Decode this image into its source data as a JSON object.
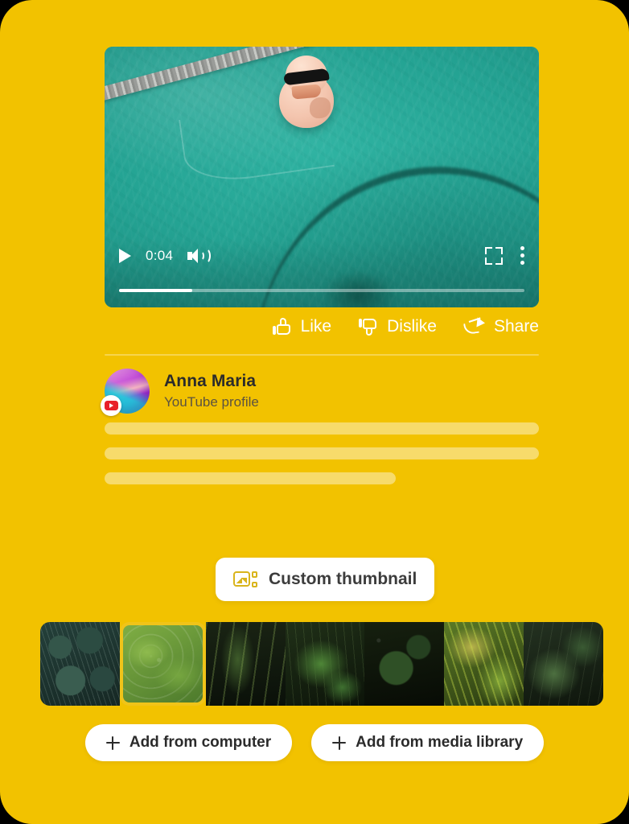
{
  "theme": {
    "background": "#F2C200",
    "accent": "#F0C419",
    "card_surface": "#FFFFFF",
    "video_tint": "#24A393",
    "youtube_red": "#E8202A"
  },
  "video": {
    "name": "pool-duck-video",
    "current_time": "0:04",
    "progress_percent": 18,
    "controls": {
      "play_icon": "play-icon",
      "volume_icon": "volume-icon",
      "fullscreen_icon": "fullscreen-icon",
      "more_icon": "more-vertical-icon"
    }
  },
  "actions": [
    {
      "label": "Like",
      "icon": "thumbs-up-icon",
      "name": "like-button"
    },
    {
      "label": "Dislike",
      "icon": "thumbs-down-icon",
      "name": "dislike-button"
    },
    {
      "label": "Share",
      "icon": "share-icon",
      "name": "share-button"
    }
  ],
  "profile": {
    "name": "Anna Maria",
    "subtitle": "YouTube profile",
    "avatar_icon": "avatar-gradient",
    "badge_icon": "youtube-badge-icon"
  },
  "skeleton_bars": [
    {
      "width_percent": 100
    },
    {
      "width_percent": 100
    },
    {
      "width_percent": 67
    }
  ],
  "custom_thumbnail": {
    "label": "Custom thumbnail",
    "icon": "image-gallery-icon"
  },
  "thumbnail_strip": {
    "selected_index": 1,
    "items": [
      {
        "alt": "striped round leaves",
        "style": "leaf-a",
        "selected": false
      },
      {
        "alt": "dewy green hosta leaves",
        "style": "leaf-b",
        "selected": true
      },
      {
        "alt": "dark elongated leaves",
        "style": "leaf-c",
        "selected": false
      },
      {
        "alt": "monstera leaf",
        "style": "leaf-d",
        "selected": false
      },
      {
        "alt": "dark foliage",
        "style": "leaf-e",
        "selected": false
      },
      {
        "alt": "bright fern fronds",
        "style": "leaf-f",
        "selected": false
      },
      {
        "alt": "large tropical leaves",
        "style": "leaf-g",
        "selected": false
      }
    ]
  },
  "bottom_buttons": [
    {
      "label": "Add from computer",
      "icon": "plus-icon",
      "name": "add-from-computer-button"
    },
    {
      "label": "Add from media library",
      "icon": "plus-icon",
      "name": "add-from-media-library-button"
    }
  ]
}
